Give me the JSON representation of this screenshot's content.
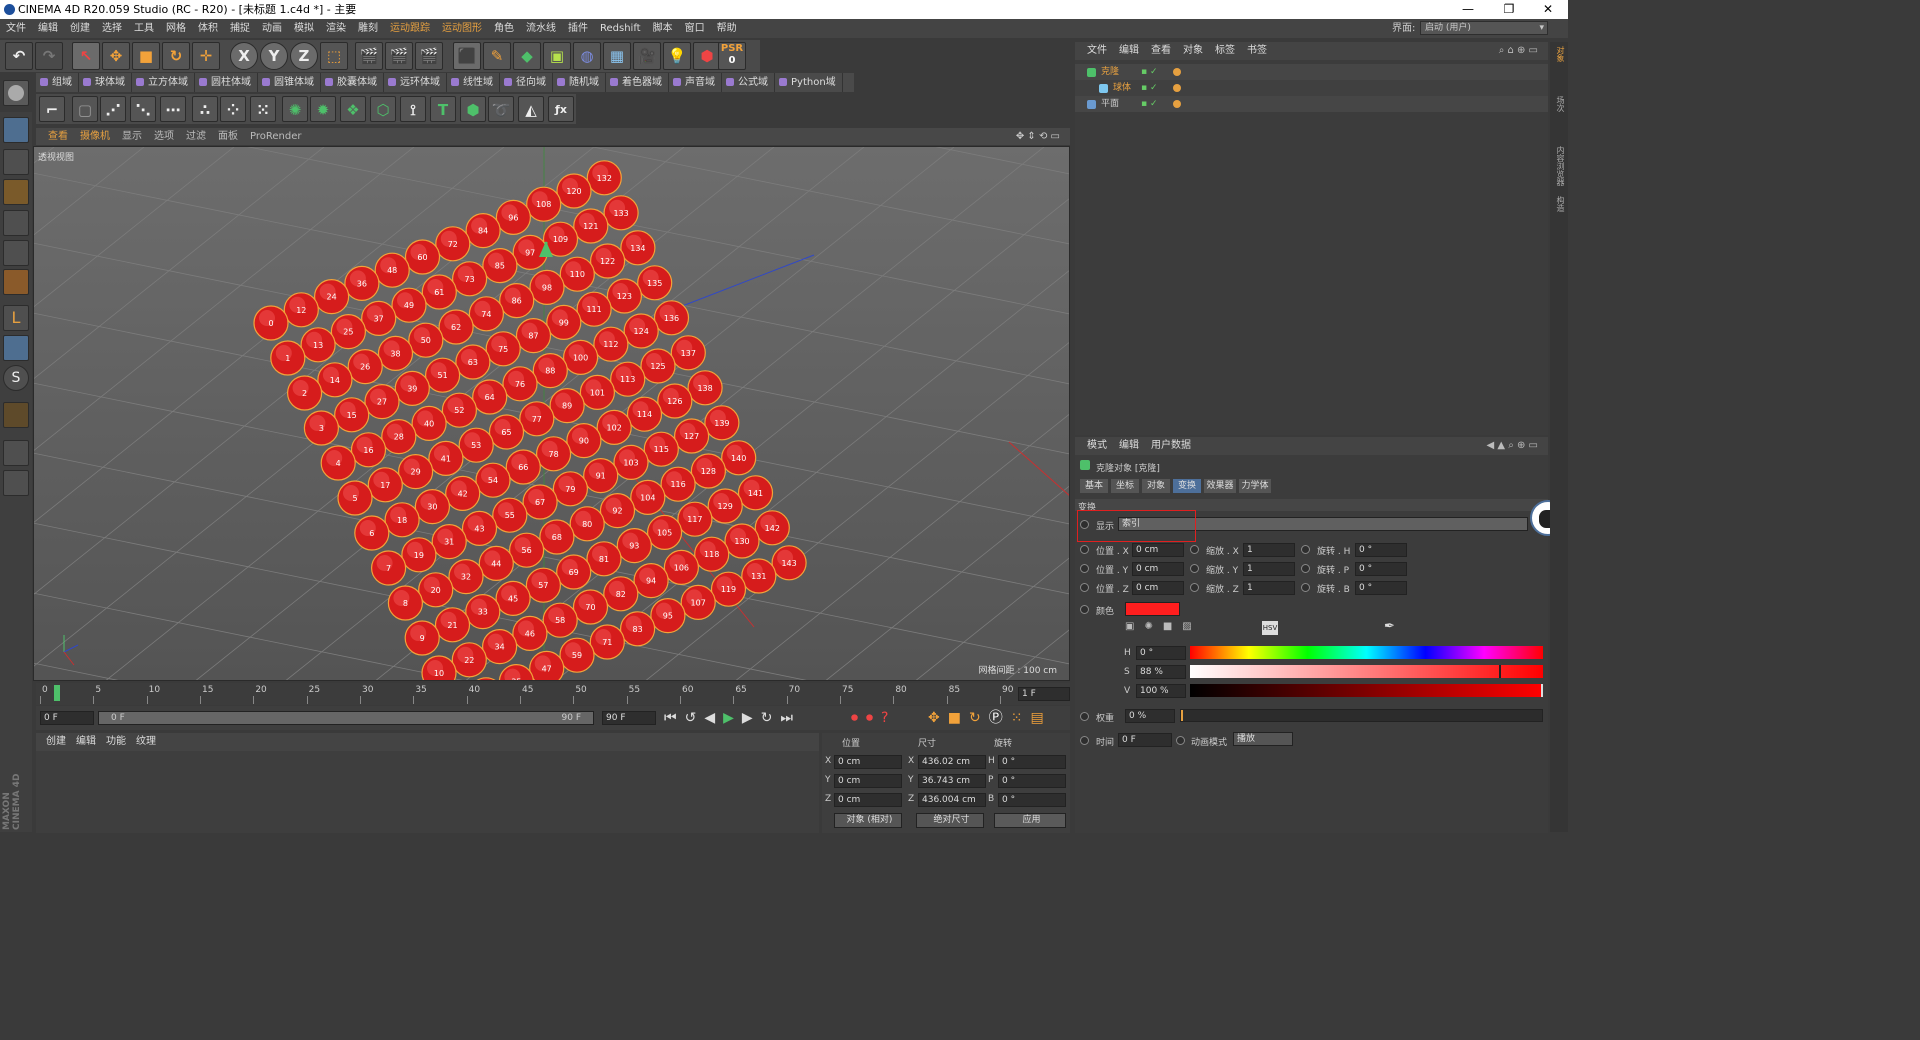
{
  "titlebar": {
    "title": "CINEMA 4D R20.059 Studio (RC - R20) - [未标题 1.c4d *] - 主要",
    "min": "—",
    "restore": "❐",
    "close": "✕"
  },
  "menu": [
    "文件",
    "编辑",
    "创建",
    "选择",
    "工具",
    "网格",
    "体积",
    "捕捉",
    "动画",
    "模拟",
    "渲染",
    "雕刻",
    "运动跟踪",
    "运动图形",
    "角色",
    "流水线",
    "插件",
    "Redshift",
    "脚本",
    "窗口",
    "帮助"
  ],
  "layout": {
    "label": "界面:",
    "value": "启动 (用户)"
  },
  "toolbar": {
    "x": "X",
    "y": "Y",
    "z": "Z",
    "psr": "PSR",
    "psr_val": "0"
  },
  "fields": [
    "组域",
    "球体域",
    "立方体域",
    "圆柱体域",
    "圆锥体域",
    "胶囊体域",
    "远环体域",
    "线性域",
    "径向域",
    "随机域",
    "着色器域",
    "声音域",
    "公式域",
    "Python域"
  ],
  "viewport": {
    "menu": [
      "查看",
      "摄像机",
      "显示",
      "选项",
      "过滤",
      "面板",
      "ProRender"
    ],
    "label": "透视视图",
    "grid": "网格间距 : 100 cm",
    "count": 144
  },
  "timeline": {
    "ticks": [
      "0",
      "5",
      "10",
      "15",
      "20",
      "25",
      "30",
      "35",
      "40",
      "45",
      "50",
      "55",
      "60",
      "65",
      "70",
      "75",
      "80",
      "85",
      "90"
    ],
    "current": "1 F",
    "start": "0 F",
    "range_start": "0 F",
    "range_end": "90 F",
    "end": "90 F"
  },
  "material": {
    "menu": [
      "创建",
      "编辑",
      "功能",
      "纹理"
    ]
  },
  "coords": {
    "headers": [
      "位置",
      "尺寸",
      "旋转"
    ],
    "rows": [
      {
        "a": "X",
        "pos": "0 cm",
        "b": "X",
        "size": "436.02 cm",
        "c": "H",
        "rot": "0 °"
      },
      {
        "a": "Y",
        "pos": "0 cm",
        "b": "Y",
        "size": "36.743 cm",
        "c": "P",
        "rot": "0 °"
      },
      {
        "a": "Z",
        "pos": "0 cm",
        "b": "Z",
        "size": "436.004 cm",
        "c": "B",
        "rot": "0 °"
      }
    ],
    "mode1": "对象 (相对)",
    "mode2": "绝对尺寸",
    "apply": "应用"
  },
  "objmgr": {
    "menu": [
      "文件",
      "编辑",
      "查看",
      "对象",
      "标签",
      "书签"
    ],
    "objects": [
      {
        "name": "克隆",
        "indent": 0,
        "color": "#e6a040"
      },
      {
        "name": "球体",
        "indent": 1,
        "color": "#e6a040"
      },
      {
        "name": "平面",
        "indent": 0,
        "color": "#cccccc"
      }
    ]
  },
  "attr": {
    "menu": [
      "模式",
      "编辑",
      "用户数据"
    ],
    "title": "克隆对象 [克隆]",
    "tabs": [
      "基本",
      "坐标",
      "对象",
      "变换",
      "效果器",
      "力学体"
    ],
    "active_tab": "变换",
    "section": "变换",
    "display_label": "显示",
    "display_value": "索引",
    "rows": [
      {
        "a": "位置 . X",
        "av": "0 cm",
        "b": "缩放 . X",
        "bv": "1",
        "c": "旋转 . H",
        "cv": "0 °"
      },
      {
        "a": "位置 . Y",
        "av": "0 cm",
        "b": "缩放 . Y",
        "bv": "1",
        "c": "旋转 . P",
        "cv": "0 °"
      },
      {
        "a": "位置 . Z",
        "av": "0 cm",
        "b": "缩放 . Z",
        "bv": "1",
        "c": "旋转 . B",
        "cv": "0 °"
      }
    ],
    "color_label": "颜色",
    "color": "#ff1e1e",
    "hsv": "HSV",
    "h_label": "H",
    "h": "0 °",
    "s_label": "S",
    "s": "88 %",
    "v_label": "V",
    "v": "100 %",
    "weight_label": "权重",
    "weight": "0 %",
    "time_label": "时间",
    "time": "0 F",
    "anim_label": "动画模式",
    "anim": "播放"
  },
  "rightstrip": [
    "对象",
    "场次",
    "内容浏览器",
    "构造"
  ],
  "maxon": "MAXON CINEMA 4D"
}
